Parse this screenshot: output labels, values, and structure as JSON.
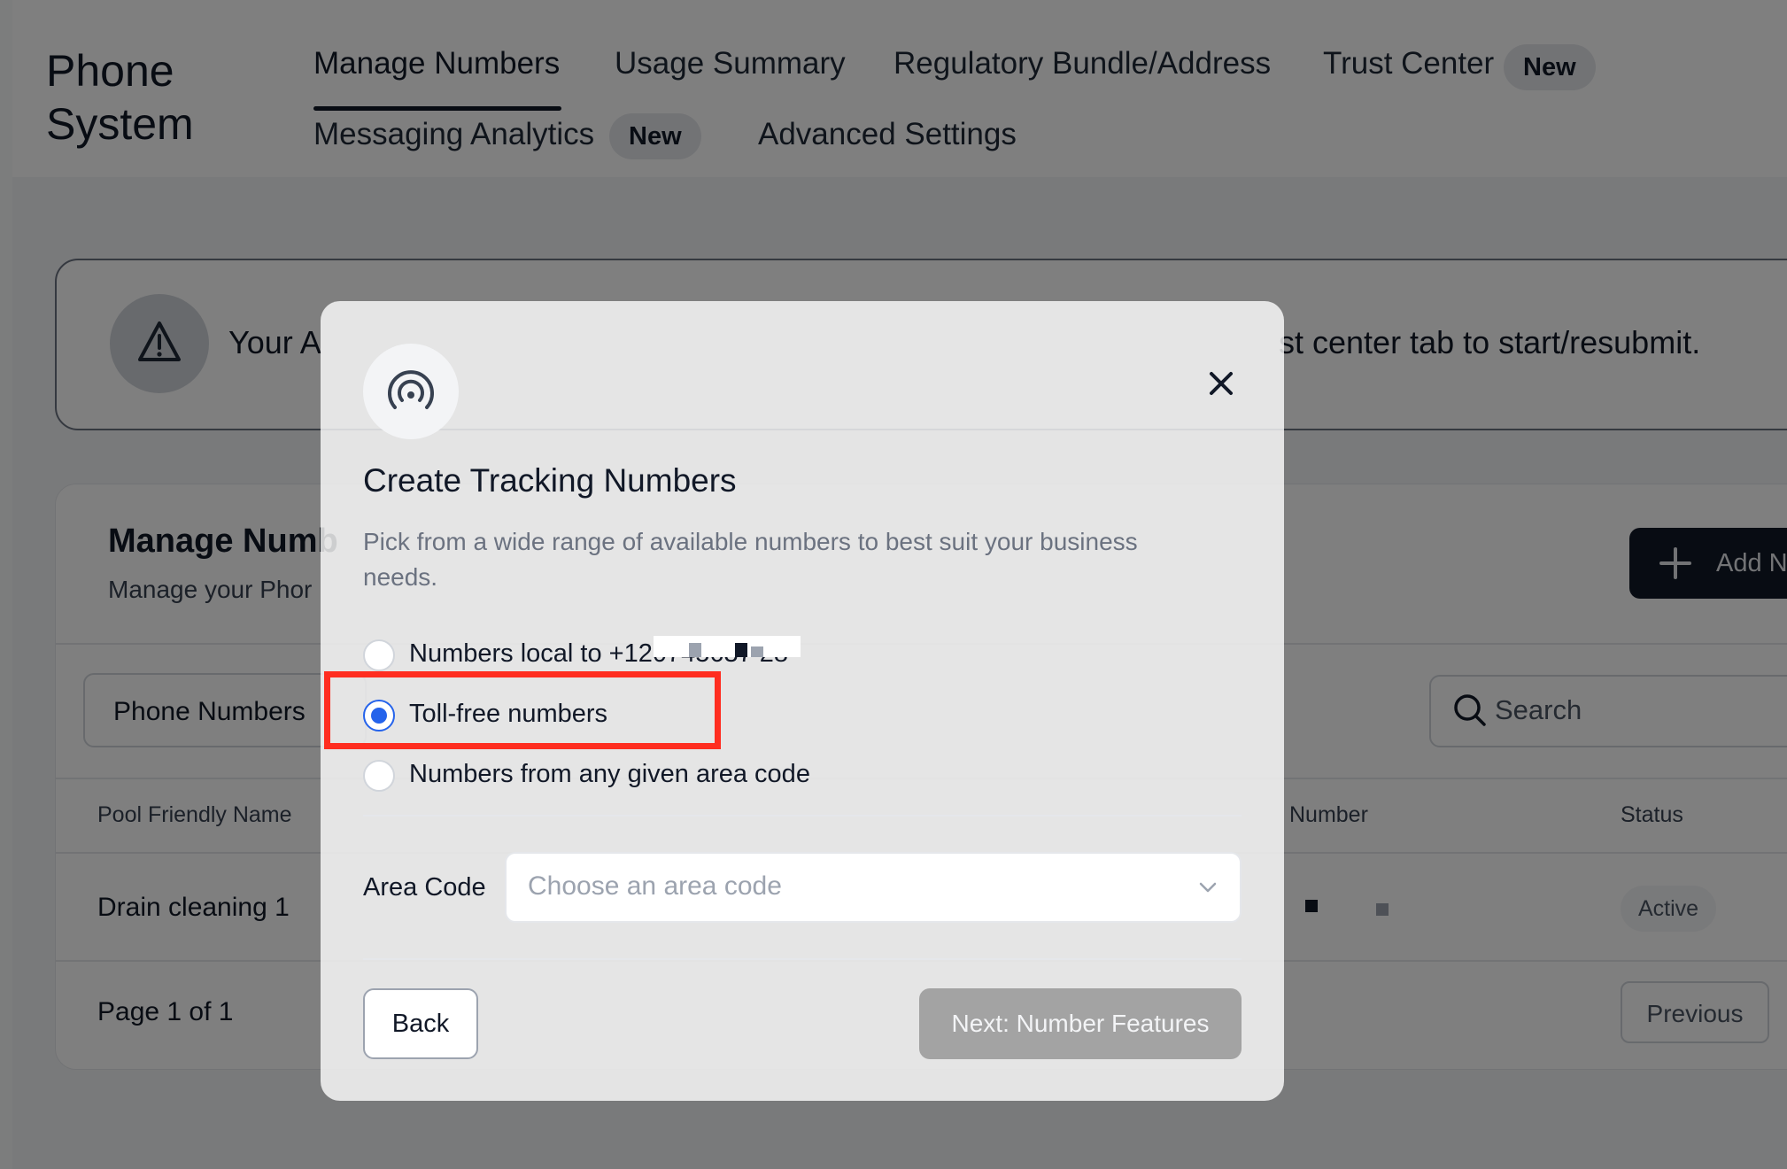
{
  "app": {
    "brand_line1": "Phone",
    "brand_line2": "System"
  },
  "nav": {
    "tabs": [
      {
        "label": "Manage Numbers",
        "active": true
      },
      {
        "label": "Usage Summary"
      },
      {
        "label": "Regulatory Bundle/Address"
      },
      {
        "label": "Trust Center",
        "badge": "New"
      },
      {
        "label": "Messaging Analytics",
        "badge": "New"
      },
      {
        "label": "Advanced Settings"
      }
    ]
  },
  "alert": {
    "text_left": "Your A",
    "text_right": "st center tab to start/resubmit."
  },
  "panel": {
    "title": "Manage Numb",
    "subtitle": "Manage your Phor",
    "add_button": "Add N",
    "filter_button": "Phone Numbers",
    "search_placeholder": "Search",
    "columns": {
      "pool_friendly_name": "Pool Friendly Name",
      "number": "Number",
      "status": "Status"
    },
    "rows": [
      {
        "pool_friendly_name": "Drain cleaning 1",
        "status": "Active"
      }
    ],
    "pagination": {
      "page_text": "Page 1 of 1",
      "previous": "Previous"
    }
  },
  "modal": {
    "title": "Create Tracking Numbers",
    "description": "Pick from a wide range of available numbers to best suit your business needs.",
    "options": [
      {
        "label": "Numbers local to +120745637 28",
        "checked": false
      },
      {
        "label": "Toll-free numbers",
        "checked": true
      },
      {
        "label": "Numbers from any given area code",
        "checked": false
      }
    ],
    "area_code_label": "Area Code",
    "area_code_placeholder": "Choose an area code",
    "back_button": "Back",
    "next_button": "Next: Number Features"
  },
  "colors": {
    "highlight": "#ff2d20",
    "radio_checked": "#2563eb",
    "next_button_disabled": "#a3a3a3"
  },
  "icons": {
    "alert": "warning-triangle-icon",
    "modal": "broadcast-signal-icon",
    "close": "close-icon",
    "search": "search-icon",
    "add": "plus-icon",
    "select": "chevron-down-icon"
  }
}
